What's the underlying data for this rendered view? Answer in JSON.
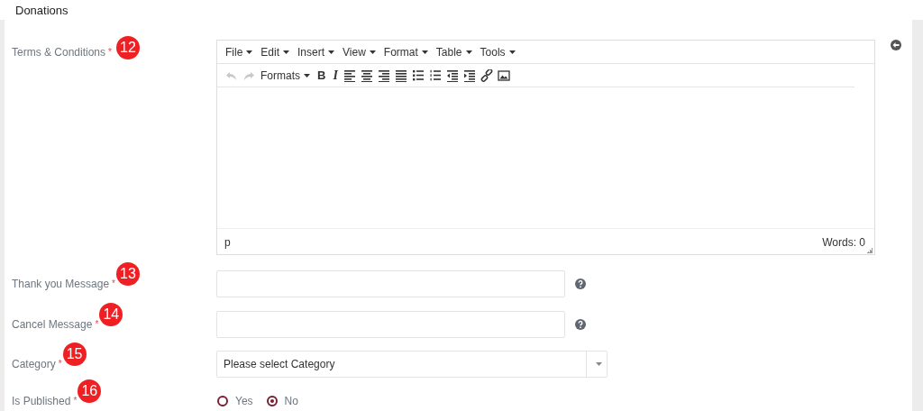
{
  "section_title": "Donations",
  "editor_menus": [
    "File",
    "Edit",
    "Insert",
    "View",
    "Format",
    "Table",
    "Tools"
  ],
  "editor_toolbar": [
    {
      "kind": "undo",
      "disabled": true
    },
    {
      "kind": "redo",
      "disabled": true
    },
    {
      "kind": "dropdown",
      "label": "Formats"
    },
    {
      "kind": "bold",
      "label": "B"
    },
    {
      "kind": "italic",
      "label": "I"
    },
    {
      "kind": "align-left"
    },
    {
      "kind": "align-center"
    },
    {
      "kind": "align-right"
    },
    {
      "kind": "justify"
    },
    {
      "kind": "bullet-list"
    },
    {
      "kind": "numbered-list"
    },
    {
      "kind": "outdent"
    },
    {
      "kind": "indent"
    },
    {
      "kind": "link"
    },
    {
      "kind": "image"
    }
  ],
  "fields": [
    {
      "kind": "editor",
      "label": "Terms & Conditions",
      "required_mark": "*",
      "badge": "12",
      "path": "p",
      "word_count": "Words: 0"
    },
    {
      "kind": "text",
      "label": "Thank you Message",
      "required_mark": "*",
      "badge": "13",
      "help": true
    },
    {
      "kind": "text",
      "label": "Cancel Message",
      "required_mark": "*",
      "badge": "14",
      "help": true
    },
    {
      "kind": "select",
      "label": "Category",
      "required_mark": "*",
      "badge": "15",
      "placeholder": "Please select Category"
    },
    {
      "kind": "radio",
      "label": "Is Published",
      "required_mark": "*",
      "badge": "16",
      "options": [
        {
          "label": "Yes",
          "selected": false
        },
        {
          "label": "No",
          "selected": true
        }
      ]
    }
  ]
}
